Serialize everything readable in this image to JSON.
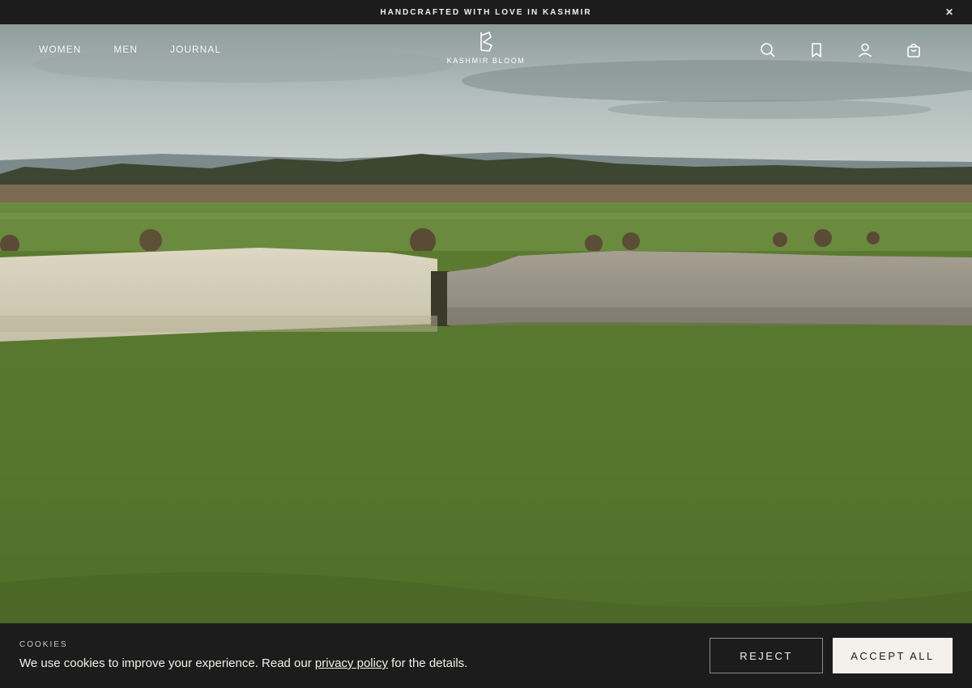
{
  "announcement": {
    "text": "HANDCRAFTED WITH LOVE IN KASHMIR",
    "close_icon": "close-icon"
  },
  "header": {
    "nav": [
      {
        "label": "WOMEN"
      },
      {
        "label": "MEN"
      },
      {
        "label": "JOURNAL"
      }
    ],
    "logo_text": "KASHMIR BLOOM",
    "icons": [
      "search-icon",
      "bookmark-icon",
      "user-icon",
      "bag-icon"
    ]
  },
  "hero": {
    "scene": "landscape-with-stone-wall"
  },
  "cookie_banner": {
    "title": "COOKIES",
    "text_before": "We use cookies to improve your experience. Read our ",
    "link": "privacy policy",
    "text_after": " for the details.",
    "reject_label": "REJECT",
    "accept_label": "ACCEPT ALL"
  },
  "colors": {
    "bar_background": "#1c1c1c",
    "cream": "#f2f0ea",
    "grass": "#4f6e2c"
  }
}
